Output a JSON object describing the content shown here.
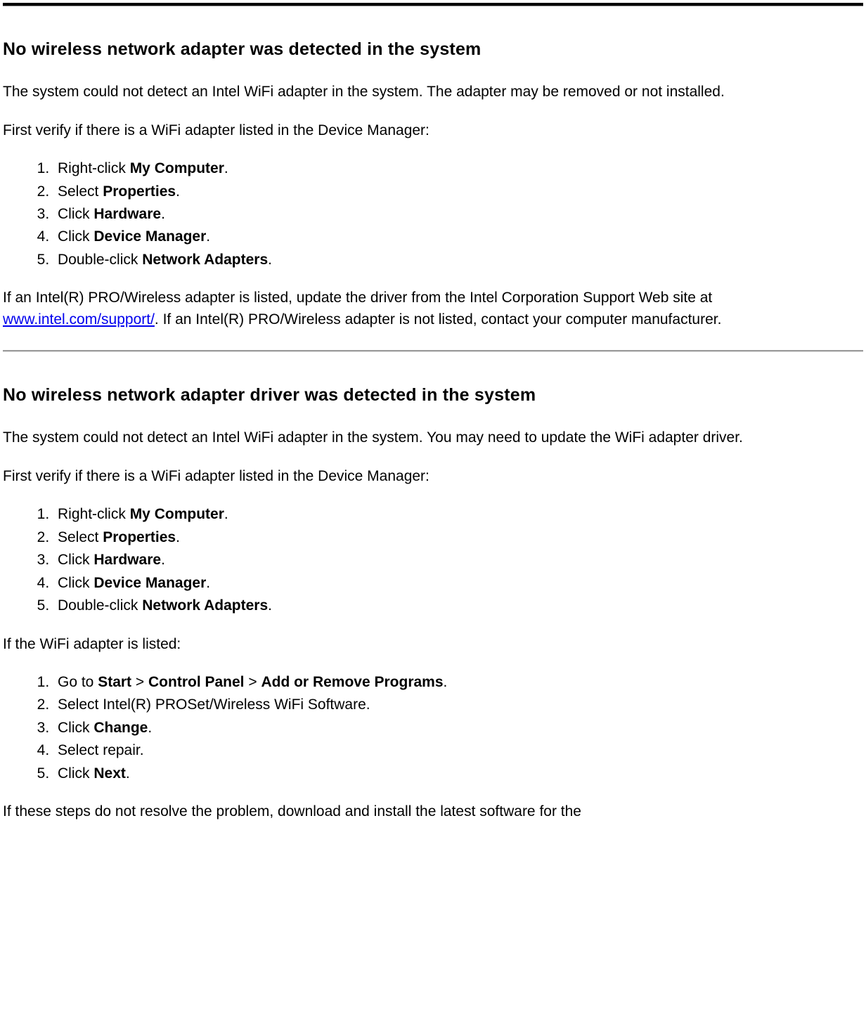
{
  "section1": {
    "heading": "No wireless network adapter was detected in the system",
    "intro": "The system could not detect an Intel WiFi adapter in the system. The adapter may be removed or not installed.",
    "verify": "First verify if there is a WiFi adapter listed in the Device Manager:",
    "steps": {
      "s1_pre": "Right-click ",
      "s1_b": "My Computer",
      "s1_post": ".",
      "s2_pre": "Select ",
      "s2_b": "Properties",
      "s2_post": ".",
      "s3_pre": "Click ",
      "s3_b": "Hardware",
      "s3_post": ".",
      "s4_pre": "Click ",
      "s4_b": "Device Manager",
      "s4_post": ".",
      "s5_pre": "Double-click ",
      "s5_b": "Network Adapters",
      "s5_post": "."
    },
    "outro_pre": "If an Intel(R) PRO/Wireless adapter is listed, update the driver from the Intel Corporation Support Web site at ",
    "outro_link": "www.intel.com/support/",
    "outro_post": ". If an Intel(R) PRO/Wireless adapter is not listed, contact your computer manufacturer."
  },
  "section2": {
    "heading": "No wireless network adapter driver was detected in the system",
    "intro": "The system could not detect an Intel WiFi adapter in the system. You may need to update the WiFi adapter driver.",
    "verify": "First verify if there is a WiFi adapter listed in the Device Manager:",
    "steps": {
      "s1_pre": "Right-click ",
      "s1_b": "My Computer",
      "s1_post": ".",
      "s2_pre": "Select ",
      "s2_b": "Properties",
      "s2_post": ".",
      "s3_pre": "Click ",
      "s3_b": "Hardware",
      "s3_post": ".",
      "s4_pre": "Click ",
      "s4_b": "Device Manager",
      "s4_post": ".",
      "s5_pre": "Double-click ",
      "s5_b": "Network Adapters",
      "s5_post": "."
    },
    "listed": "If the WiFi adapter is listed:",
    "steps2": {
      "s1_pre": "Go to ",
      "s1_b1": "Start",
      "s1_mid1": " > ",
      "s1_b2": "Control Panel",
      "s1_mid2": " > ",
      "s1_b3": "Add or Remove Programs",
      "s1_post": ".",
      "s2": "Select Intel(R) PROSet/Wireless WiFi Software.",
      "s3_pre": "Click ",
      "s3_b": "Change",
      "s3_post": ".",
      "s4": "Select repair.",
      "s5_pre": "Click ",
      "s5_b": "Next",
      "s5_post": "."
    },
    "outro": "If these steps do not resolve the problem, download and install the latest software for the"
  }
}
